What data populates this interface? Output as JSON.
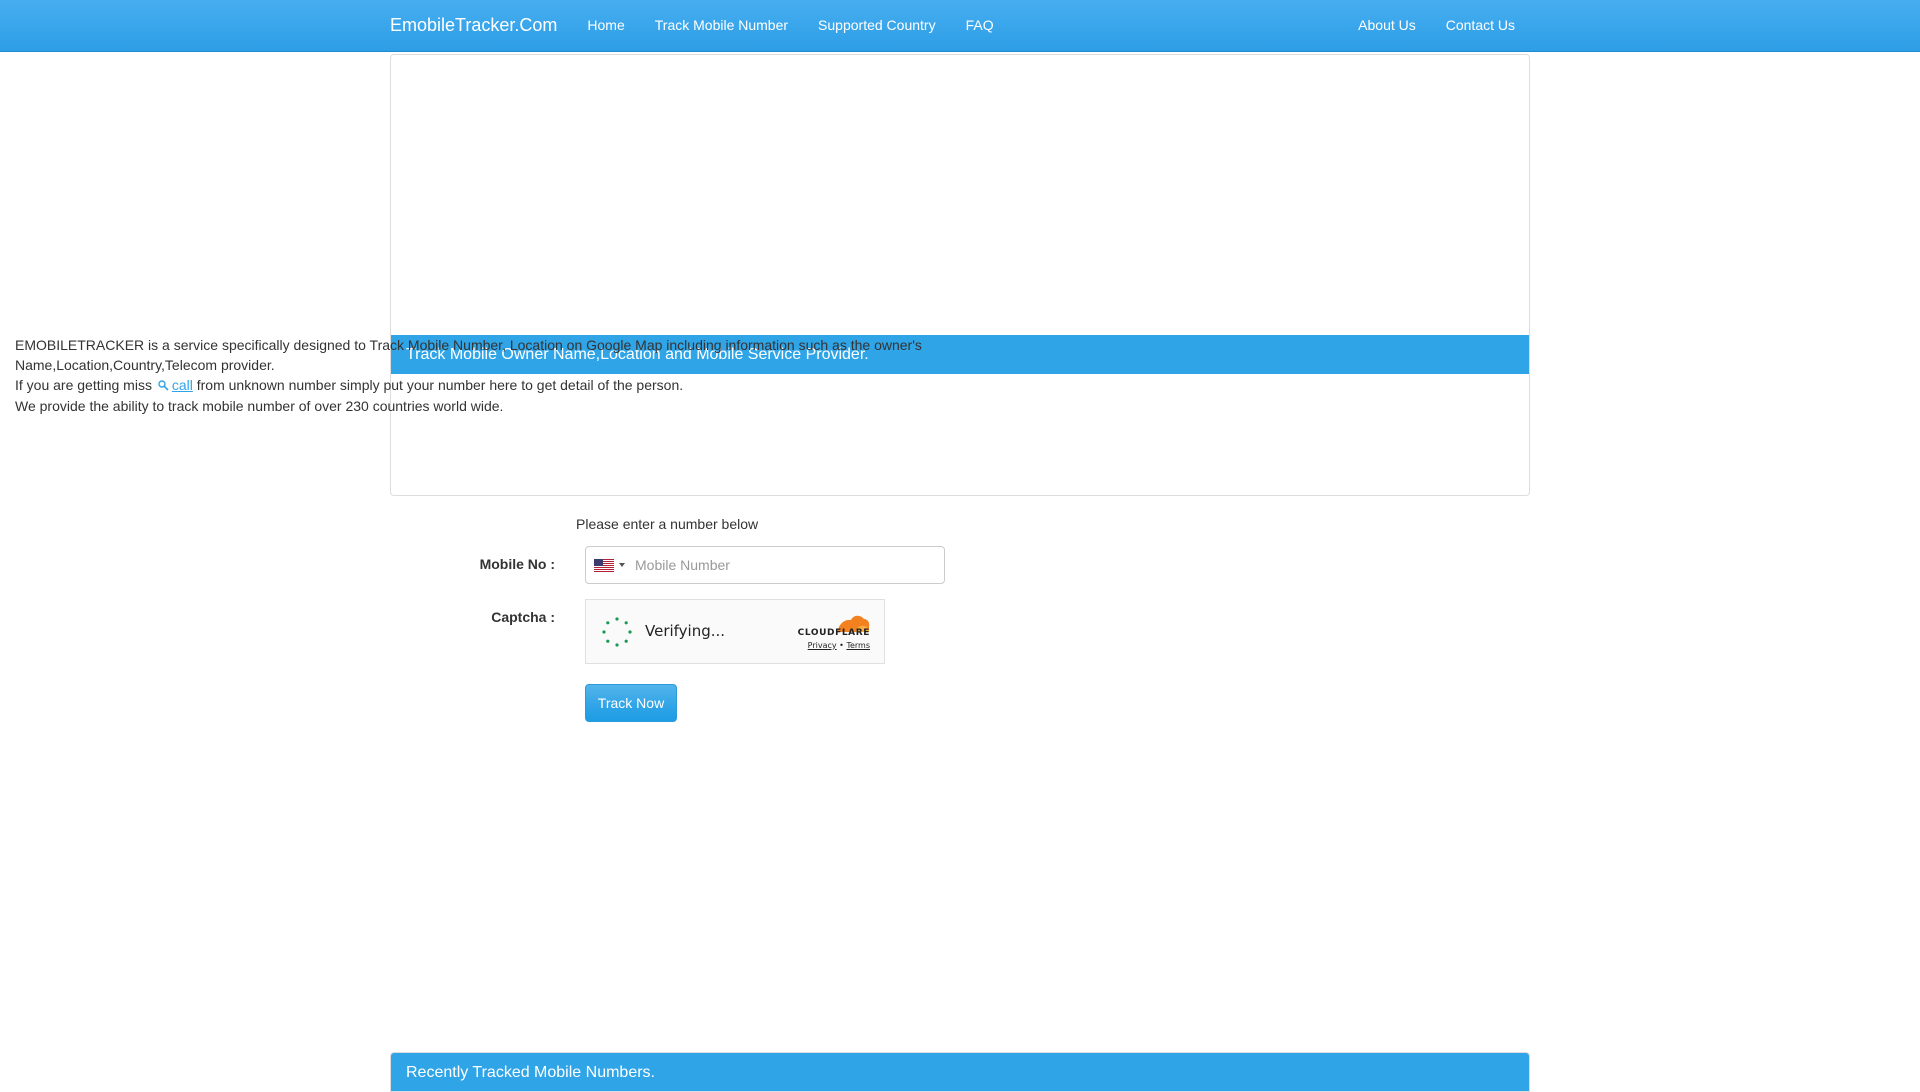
{
  "navbar": {
    "brand": "EmobileTracker.Com",
    "left_links": [
      "Home",
      "Track Mobile Number",
      "Supported Country",
      "FAQ"
    ],
    "right_links": [
      "About Us",
      "Contact Us"
    ],
    "color": "#2fa4e7"
  },
  "intro_panel": {
    "heading": "Track Mobile Owner Name,Location and Mobile Service Provider.",
    "line1": "EMOBILETRACKER is a service specifically designed to Track Mobile Number, Location on Google Map including information such as the owner's Name,Location,Country,Telecom provider.",
    "line2_before": "If you are getting miss",
    "line2_link": "call",
    "line2_after": "from unknown number simply put your number here to get detail of the person.",
    "line3": "We provide the ability to track mobile number of over 230 countries world wide."
  },
  "form": {
    "hint": "Please enter a number below",
    "mobile_label": "Mobile No :",
    "mobile_placeholder": "Mobile Number",
    "mobile_value": "",
    "country_flag": "us-flag-icon",
    "captcha_label": "Captcha :",
    "captcha_status": "Verifying...",
    "captcha_brand": "CLOUDFLARE",
    "captcha_privacy": "Privacy",
    "captcha_separator": "•",
    "captcha_terms": "Terms",
    "submit_label": "Track Now"
  },
  "recent_panel": {
    "heading": "Recently Tracked Mobile Numbers."
  }
}
